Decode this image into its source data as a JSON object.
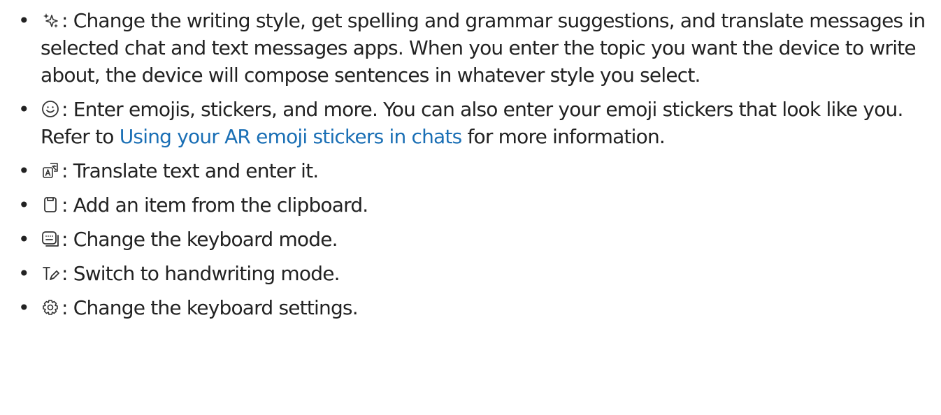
{
  "items": [
    {
      "icon": "sparkle-icon",
      "text": ": Change the writing style, get spelling and grammar suggestions, and translate messages in selected chat and text messages apps. When you enter the topic you want the device to write about, the device will compose sentences in whatever style you select."
    },
    {
      "icon": "emoji-icon",
      "text_before": ": Enter emojis, stickers, and more. You can also enter your emoji stickers that look like you. Refer to ",
      "link": "Using your AR emoji stickers in chats",
      "text_after": " for more information."
    },
    {
      "icon": "translate-icon",
      "text": ": Translate text and enter it."
    },
    {
      "icon": "clipboard-icon",
      "text": ": Add an item from the clipboard."
    },
    {
      "icon": "keyboard-icon",
      "text": ": Change the keyboard mode."
    },
    {
      "icon": "handwriting-icon",
      "text": ": Switch to handwriting mode."
    },
    {
      "icon": "settings-gear-icon",
      "text": ": Change the keyboard settings."
    }
  ],
  "colors": {
    "text": "#222222",
    "link": "#1a6fb5",
    "icon": "#333333"
  }
}
